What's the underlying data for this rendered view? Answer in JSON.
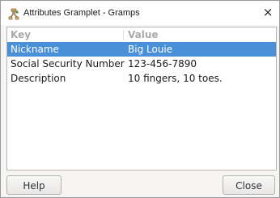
{
  "window": {
    "title": "Attributes Gramplet - Gramps",
    "icon": "gramps-app-icon",
    "close_glyph": "×"
  },
  "list": {
    "columns": [
      "Key",
      "Value"
    ],
    "rows": [
      {
        "key": "Nickname",
        "value": "Big Louie",
        "selected": true
      },
      {
        "key": "Social Security Number",
        "value": "123-456-7890",
        "selected": false
      },
      {
        "key": "Description",
        "value": "10 fingers, 10 toes.",
        "selected": false
      }
    ]
  },
  "buttons": {
    "help_label": "Help",
    "close_label": "Close"
  },
  "colors": {
    "selection": "#4a90d9",
    "header_text": "#a9a9a9"
  }
}
